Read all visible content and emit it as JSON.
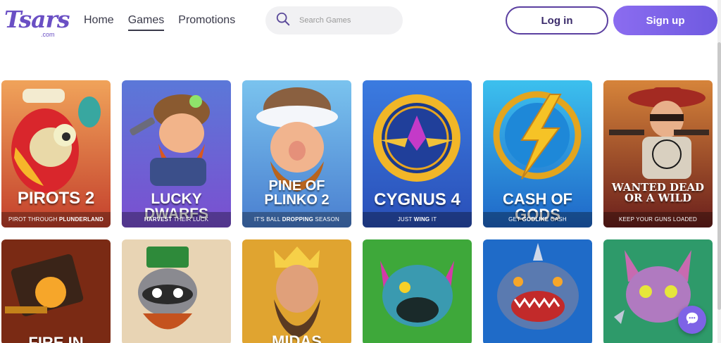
{
  "logo": {
    "main": "Tsars",
    "sub": ".com"
  },
  "nav": [
    {
      "label": "Home"
    },
    {
      "label": "Games"
    },
    {
      "label": "Promotions"
    }
  ],
  "search": {
    "placeholder": "Search Games",
    "icon": "search-icon"
  },
  "auth": {
    "login_label": "Log in",
    "signup_label": "Sign up"
  },
  "colors": {
    "accent": "#7e63e6",
    "login_border": "#5b3fa0"
  },
  "games_row1": [
    {
      "title": "PIROTS 2",
      "tag_pre": "PIROT THROUGH ",
      "tag_bold": "PLUNDERLAND",
      "tag_post": ""
    },
    {
      "title": "LUCKY DWARFS",
      "tag_pre": "",
      "tag_bold": "HARVEST",
      "tag_post": " THEIR LUCK"
    },
    {
      "title": "PINE OF PLINKO 2",
      "tag_pre": "IT'S BALL ",
      "tag_bold": "DROPPING",
      "tag_post": " SEASON"
    },
    {
      "title": "CYGNUS 4",
      "tag_pre": "JUST ",
      "tag_bold": "WING",
      "tag_post": " IT"
    },
    {
      "title": "CASH OF GODS",
      "tag_pre": "GET ",
      "tag_bold": "GODLIKE",
      "tag_post": " CASH"
    },
    {
      "title": "WANTED DEAD OR A WILD",
      "tag_pre": "KEEP YOUR GUNS LOADED",
      "tag_bold": "",
      "tag_post": ""
    }
  ],
  "games_row2": [
    {
      "title": "FIRE IN"
    },
    {
      "title": ""
    },
    {
      "title": "MIDAS"
    },
    {
      "title": ""
    },
    {
      "title": ""
    },
    {
      "title": ""
    }
  ],
  "chat": {
    "icon": "chat-bubble-icon"
  }
}
